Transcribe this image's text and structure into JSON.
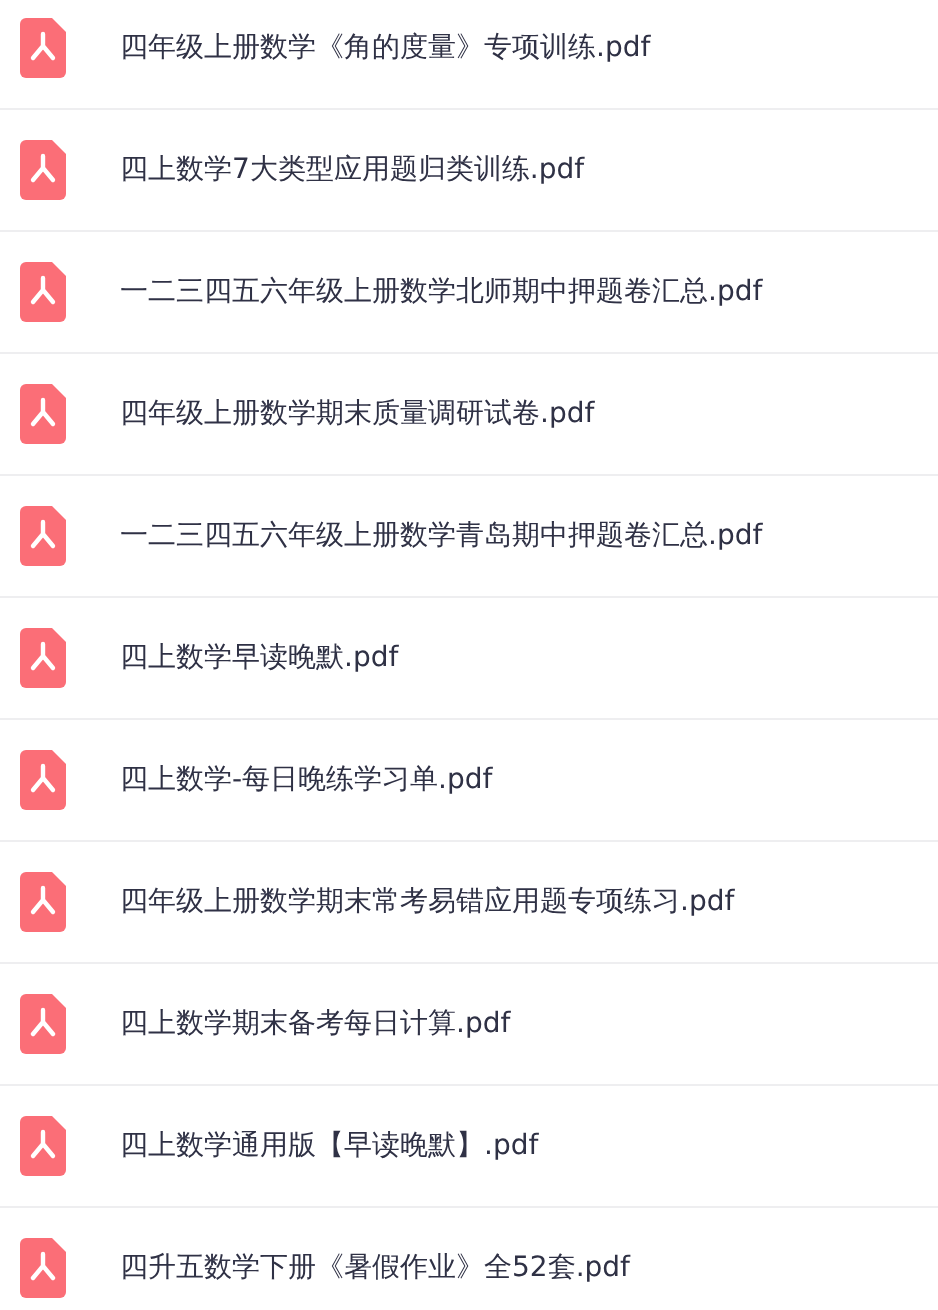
{
  "files": [
    {
      "name": "四年级上册数学《角的度量》专项训练.pdf"
    },
    {
      "name": "四上数学7大类型应用题归类训练.pdf"
    },
    {
      "name": "一二三四五六年级上册数学北师期中押题卷汇总.pdf"
    },
    {
      "name": "四年级上册数学期末质量调研试卷.pdf"
    },
    {
      "name": "一二三四五六年级上册数学青岛期中押题卷汇总.pdf"
    },
    {
      "name": "四上数学早读晚默.pdf"
    },
    {
      "name": "四上数学-每日晚练学习单.pdf"
    },
    {
      "name": "四年级上册数学期末常考易错应用题专项练习.pdf"
    },
    {
      "name": "四上数学期末备考每日计算.pdf"
    },
    {
      "name": "四上数学通用版【早读晚默】.pdf"
    },
    {
      "name": "四升五数学下册《暑假作业》全52套.pdf"
    }
  ]
}
